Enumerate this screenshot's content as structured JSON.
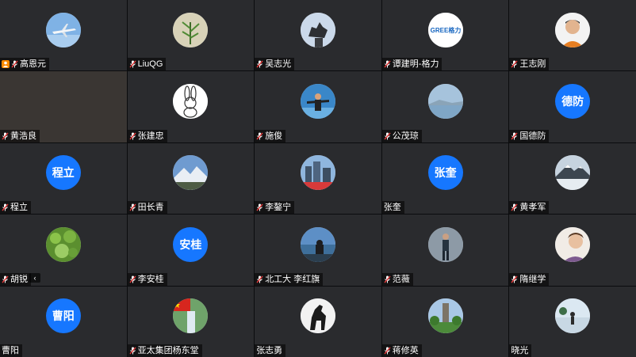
{
  "participants": [
    {
      "name": "高恩元",
      "avatar": "photo",
      "photo_desc": "airplane-photo",
      "host": true
    },
    {
      "name": "LiuQG",
      "avatar": "photo",
      "photo_desc": "plant-photo"
    },
    {
      "name": "吴志光",
      "avatar": "photo",
      "photo_desc": "statue-photo"
    },
    {
      "name": "谭建明-格力",
      "avatar": "photo",
      "photo_desc": "gree-logo"
    },
    {
      "name": "王志刚",
      "avatar": "photo",
      "photo_desc": "portrait-photo"
    },
    {
      "name": "黄浩良",
      "avatar": "video"
    },
    {
      "name": "张建忠",
      "avatar": "photo",
      "photo_desc": "rabbit-drawing"
    },
    {
      "name": "施俊",
      "avatar": "photo",
      "photo_desc": "person-photo"
    },
    {
      "name": "公茂琼",
      "avatar": "photo",
      "photo_desc": "lake-photo"
    },
    {
      "name": "国德防",
      "avatar": "initials",
      "initials": "德防"
    },
    {
      "name": "程立",
      "avatar": "initials",
      "initials": "程立"
    },
    {
      "name": "田长青",
      "avatar": "photo",
      "photo_desc": "mountain-photo"
    },
    {
      "name": "李鏊宁",
      "avatar": "photo",
      "photo_desc": "city-photo"
    },
    {
      "name": "张奎",
      "avatar": "initials",
      "initials": "张奎",
      "no_mic": true
    },
    {
      "name": "黄孝军",
      "avatar": "photo",
      "photo_desc": "snow-mountain-photo"
    },
    {
      "name": "胡锐",
      "avatar": "photo",
      "photo_desc": "leaves-photo"
    },
    {
      "name": "李安桂",
      "avatar": "initials",
      "initials": "安桂"
    },
    {
      "name": "北工大 李红旗",
      "avatar": "photo",
      "photo_desc": "coast-photo"
    },
    {
      "name": "范薇",
      "avatar": "photo",
      "photo_desc": "woman-photo"
    },
    {
      "name": "隋继学",
      "avatar": "photo",
      "photo_desc": "boy-photo"
    },
    {
      "name": "曹阳",
      "avatar": "initials",
      "initials": "曹阳",
      "no_mic": true
    },
    {
      "name": "亚太集团杨东堂",
      "avatar": "photo",
      "photo_desc": "waterfall-flag-photo"
    },
    {
      "name": "张志勇",
      "avatar": "photo",
      "photo_desc": "horse-photo",
      "no_mic": true
    },
    {
      "name": "蒋修英",
      "avatar": "photo",
      "photo_desc": "tower-photo"
    },
    {
      "name": "晓光",
      "avatar": "photo",
      "photo_desc": "beach-photo",
      "no_mic": true
    }
  ],
  "colors": {
    "tile_bg": "#2a2b2e",
    "initials_bg": "#1677ff",
    "host_badge": "#ff8a00",
    "muted_mic": "#e23b3b"
  }
}
